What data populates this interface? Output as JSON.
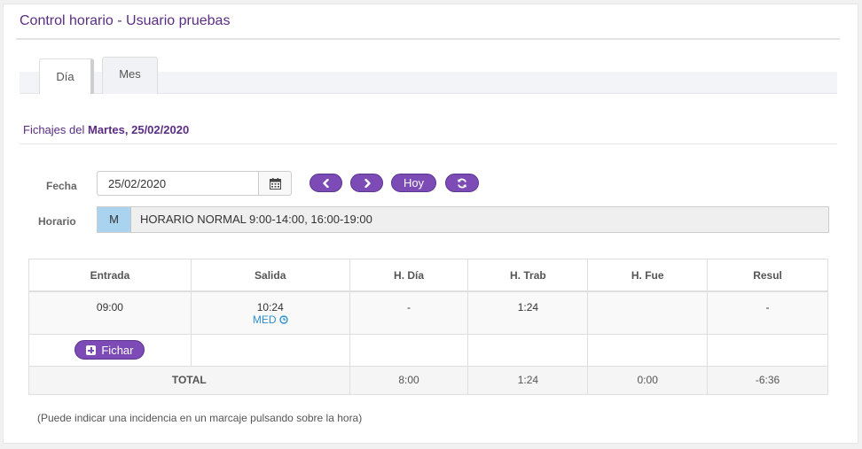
{
  "header": {
    "title": "Control horario - Usuario pruebas"
  },
  "tabs": [
    {
      "label": "Día",
      "active": true
    },
    {
      "label": "Mes",
      "active": false
    }
  ],
  "section": {
    "prefix": "Fichajes del ",
    "date": "Martes, 25/02/2020"
  },
  "form": {
    "fecha_label": "Fecha",
    "fecha_value": "25/02/2020",
    "calendar_icon": "calendar-icon",
    "prev_icon": "chevron-left-icon",
    "next_icon": "chevron-right-icon",
    "hoy_label": "Hoy",
    "refresh_icon": "refresh-icon",
    "horario_label": "Horario",
    "horario_code": "M",
    "horario_text": "HORARIO NORMAL 9:00-14:00, 16:00-19:00"
  },
  "table": {
    "headers": [
      "Entrada",
      "Salida",
      "H. Día",
      "H. Trab",
      "H. Fue",
      "Resul"
    ],
    "row": {
      "entrada": "09:00",
      "salida": "10:24",
      "salida_tag": "MED",
      "h_dia": "-",
      "h_trab": "1:24",
      "h_fue": "",
      "resul": "-"
    },
    "fichar_label": "Fichar",
    "total": {
      "label": "TOTAL",
      "h_dia": "8:00",
      "h_trab": "1:24",
      "h_fue": "0:00",
      "resul": "-6:36"
    }
  },
  "note": "(Puede indicar una incidencia en un marcaje pulsando sobre la hora)",
  "colors": {
    "accent": "#7c4bb5",
    "title": "#5a2d82",
    "link": "#2d8fcf",
    "schedule_code": "#a9d3ef"
  }
}
